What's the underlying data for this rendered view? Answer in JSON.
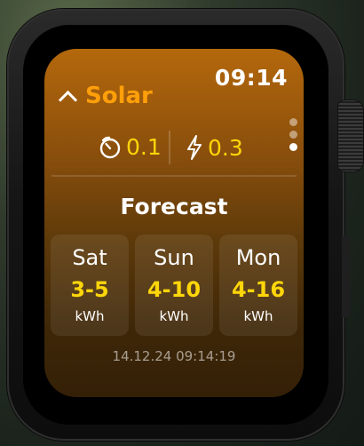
{
  "status": {
    "time": "09:14"
  },
  "header": {
    "title": "Solar"
  },
  "stats": {
    "left_value": "0.1",
    "right_value": "0.3"
  },
  "pager": {
    "count": 3,
    "active_index": 2
  },
  "forecast": {
    "title": "Forecast",
    "days": [
      {
        "day": "Sat",
        "range": "3-5",
        "unit": "kWh"
      },
      {
        "day": "Sun",
        "range": "4-10",
        "unit": "kWh"
      },
      {
        "day": "Mon",
        "range": "4-16",
        "unit": "kWh"
      }
    ]
  },
  "footer": {
    "timestamp": "14.12.24 09:14:19"
  },
  "colors": {
    "accent": "#ff9f0a",
    "value": "#ffd60a",
    "screen_top": "#b4680c",
    "screen_bottom": "#342007"
  }
}
